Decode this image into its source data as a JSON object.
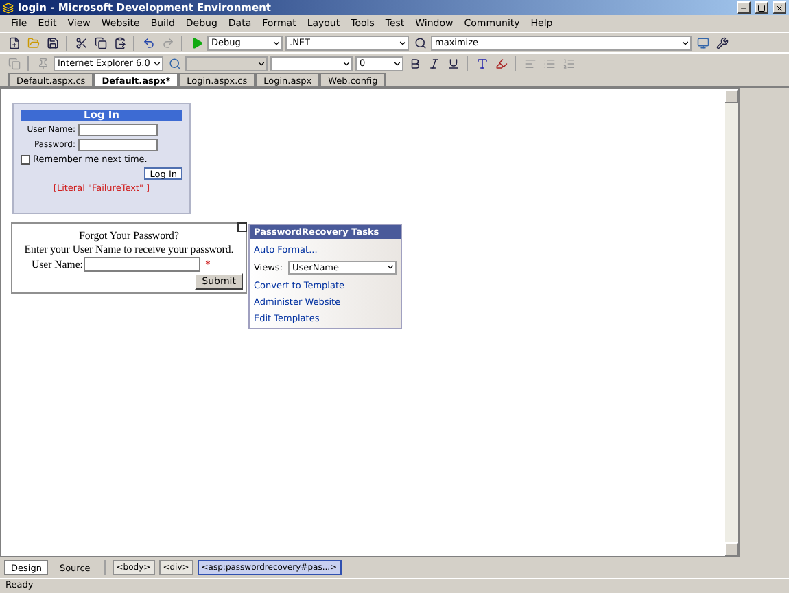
{
  "window": {
    "title": "login - Microsoft Development Environment"
  },
  "menu": [
    "File",
    "Edit",
    "View",
    "Website",
    "Build",
    "Debug",
    "Data",
    "Format",
    "Layout",
    "Tools",
    "Test",
    "Window",
    "Community",
    "Help"
  ],
  "toolbar": {
    "configuration": "Debug",
    "platform": ".NET",
    "find": "maximize",
    "target_schema": "Internet Explorer 6.0",
    "font_size": "0"
  },
  "tabs": [
    {
      "label": "Default.aspx.cs",
      "selected": false
    },
    {
      "label": "Default.aspx*",
      "selected": true
    },
    {
      "label": "Login.aspx.cs",
      "selected": false
    },
    {
      "label": "Login.aspx",
      "selected": false
    },
    {
      "label": "Web.config",
      "selected": false
    }
  ],
  "login": {
    "title": "Log In",
    "user_label": "User Name:",
    "password_label": "Password:",
    "remember": "Remember me next time.",
    "remember_checked": false,
    "button": "Log In",
    "failure": "[Literal \"FailureText\" ]"
  },
  "recovery": {
    "title": "Forgot Your Password?",
    "instruction": "Enter your User Name to receive your password.",
    "user_label": "User Name:",
    "required_mark": "*",
    "button": "Submit"
  },
  "smart_tag": {
    "title": "PasswordRecovery Tasks",
    "auto_format": "Auto Format...",
    "views_label": "Views:",
    "views_value": "UserName",
    "links": [
      "Convert to Template",
      "Administer Website",
      "Edit Templates"
    ]
  },
  "view_tabs": [
    {
      "label": "Design",
      "selected": true
    },
    {
      "label": "Source",
      "selected": false
    }
  ],
  "breadcrumb": [
    {
      "label": "<body>",
      "selected": false
    },
    {
      "label": "<div>",
      "selected": false
    },
    {
      "label": "<asp:passwordrecovery#pas...>",
      "selected": true
    }
  ],
  "status_bar": "Ready"
}
